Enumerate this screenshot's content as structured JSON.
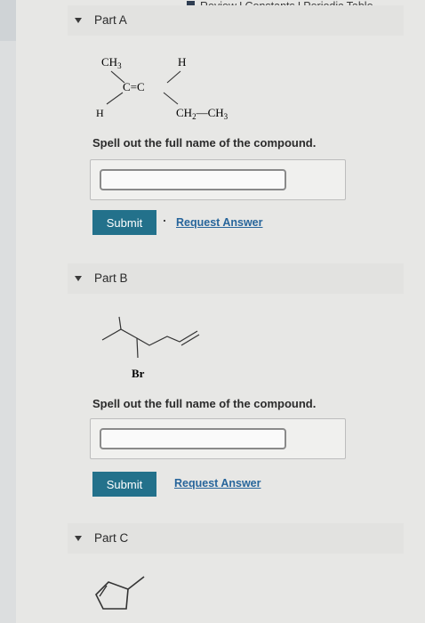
{
  "header": {
    "links": [
      "Review",
      "Constants",
      "Periodic Table"
    ],
    "separator": "I"
  },
  "parts": [
    {
      "label": "Part A",
      "structure": {
        "ch3": "CH",
        "ch3_sub": "3",
        "h_top": "H",
        "double_bond": "C=C",
        "h_bottom": "H",
        "ethyl_ch2": "CH",
        "ethyl_ch2_sub": "2",
        "ethyl_dash": "—",
        "ethyl_ch3": "CH",
        "ethyl_ch3_sub": "3"
      },
      "prompt": "Spell out the full name of the compound.",
      "answer_value": "",
      "submit_label": "Submit",
      "request_label": "Request Answer"
    },
    {
      "label": "Part B",
      "structure": {
        "substituent": "Br"
      },
      "prompt": "Spell out the full name of the compound.",
      "answer_value": "",
      "submit_label": "Submit",
      "request_label": "Request Answer"
    },
    {
      "label": "Part C"
    }
  ],
  "colors": {
    "submit_bg": "#23718b",
    "link": "#27659b",
    "page_bg": "#e7e7e5"
  }
}
